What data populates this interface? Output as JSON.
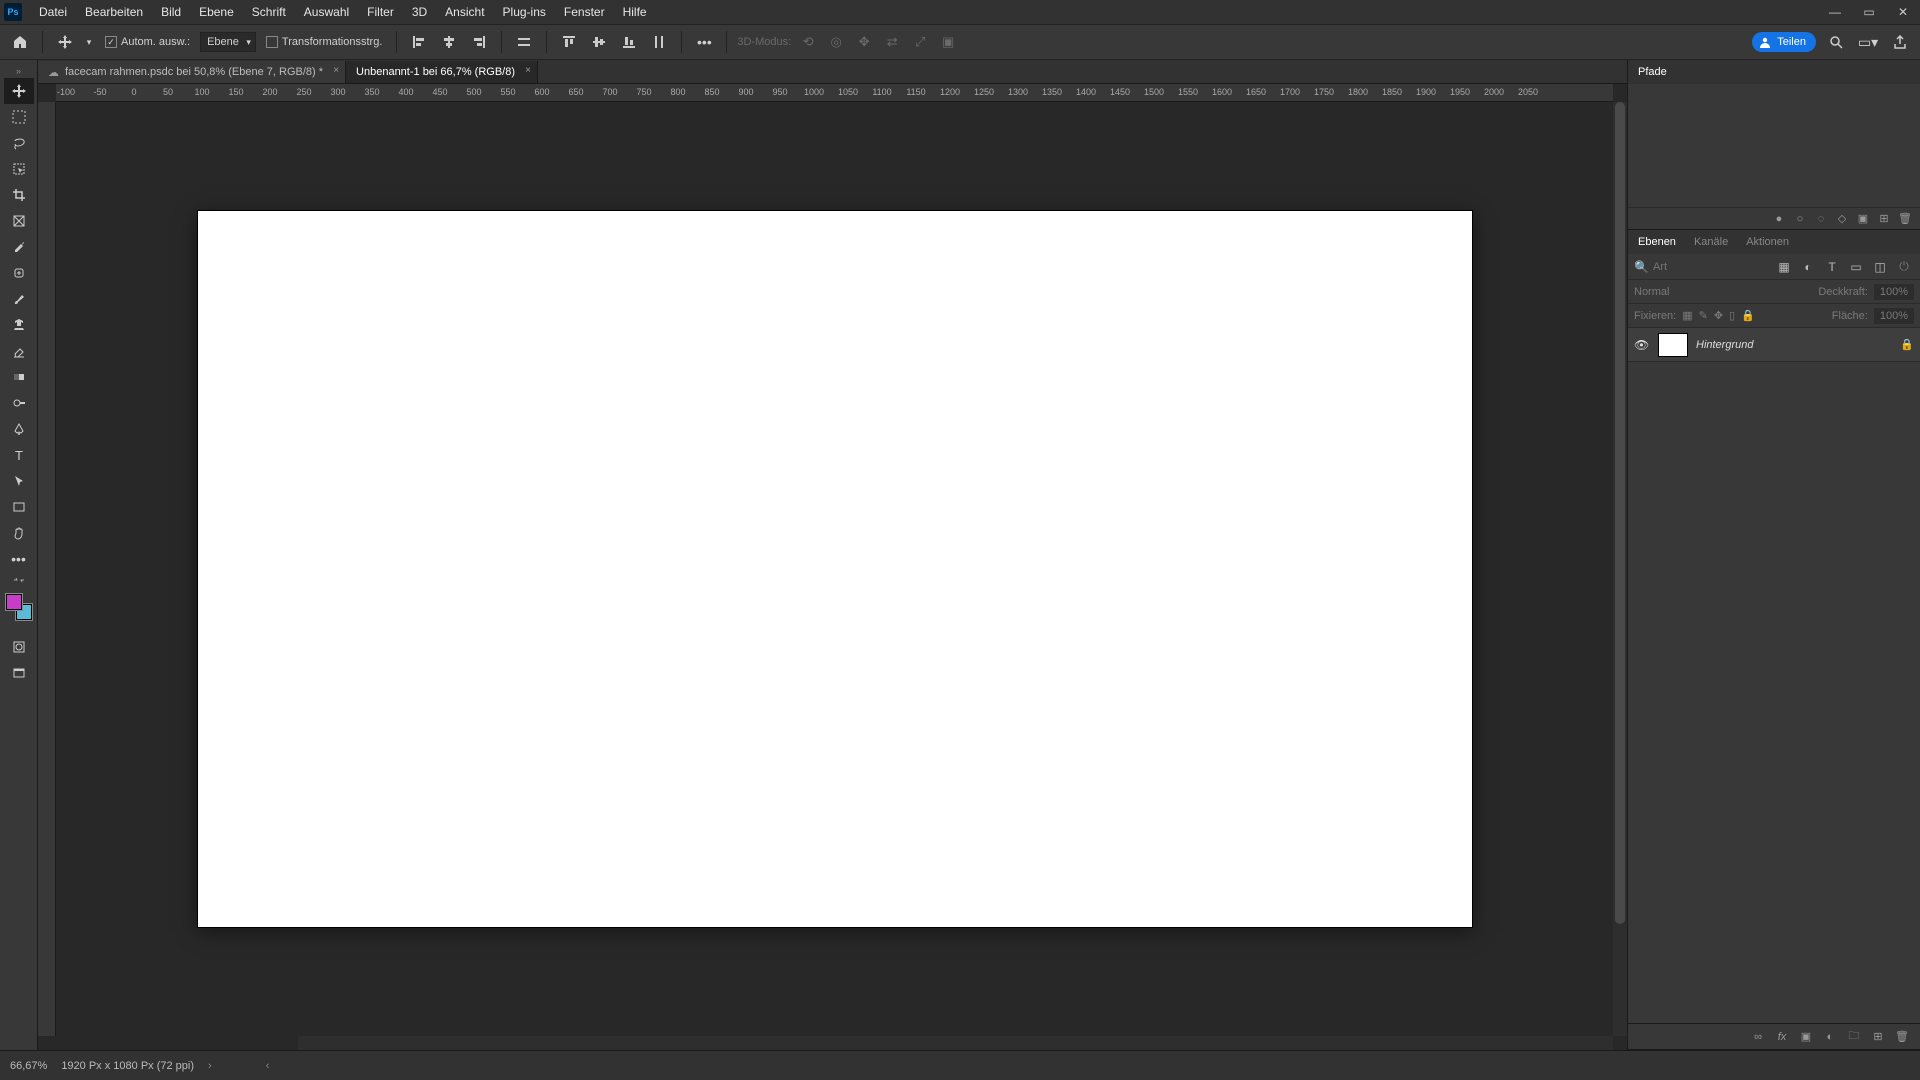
{
  "app": {
    "logo": "Ps"
  },
  "menu": [
    "Datei",
    "Bearbeiten",
    "Bild",
    "Ebene",
    "Schrift",
    "Auswahl",
    "Filter",
    "3D",
    "Ansicht",
    "Plug-ins",
    "Fenster",
    "Hilfe"
  ],
  "options": {
    "auto_select_label": "Autom. ausw.:",
    "target_dd": "Ebene",
    "transform_label": "Transformationsstrg.",
    "mode_3d_label": "3D-Modus:",
    "share_label": "Teilen"
  },
  "tabs": [
    {
      "title": "facecam rahmen.psdc bei 50,8% (Ebene 7, RGB/8) *",
      "active": false,
      "cloud": true
    },
    {
      "title": "Unbenannt-1 bei 66,7% (RGB/8)",
      "active": true,
      "cloud": false
    }
  ],
  "ruler_ticks": [
    "-100",
    "-50",
    "0",
    "50",
    "100",
    "150",
    "200",
    "250",
    "300",
    "350",
    "400",
    "450",
    "500",
    "550",
    "600",
    "650",
    "700",
    "750",
    "800",
    "850",
    "900",
    "950",
    "1000",
    "1050",
    "1100",
    "1150",
    "1200",
    "1250",
    "1300",
    "1350",
    "1400",
    "1450",
    "1500",
    "1550",
    "1600",
    "1650",
    "1700",
    "1750",
    "1800",
    "1850",
    "1900",
    "1950",
    "2000",
    "2050"
  ],
  "panels": {
    "paths": {
      "tab": "Pfade"
    },
    "layers": {
      "tabs": [
        "Ebenen",
        "Kanäle",
        "Aktionen"
      ],
      "filter_placeholder": "Art",
      "blend_label": "Normal",
      "opacity_label": "Deckkraft:",
      "opacity_value": "100%",
      "lock_label": "Fixieren:",
      "fill_label": "Fläche:",
      "fill_value": "100%",
      "layer_name": "Hintergrund"
    }
  },
  "status": {
    "zoom": "66,67%",
    "doc_info": "1920 Px x 1080 Px (72 ppi)"
  },
  "colors": {
    "accent": "#1473e6"
  }
}
